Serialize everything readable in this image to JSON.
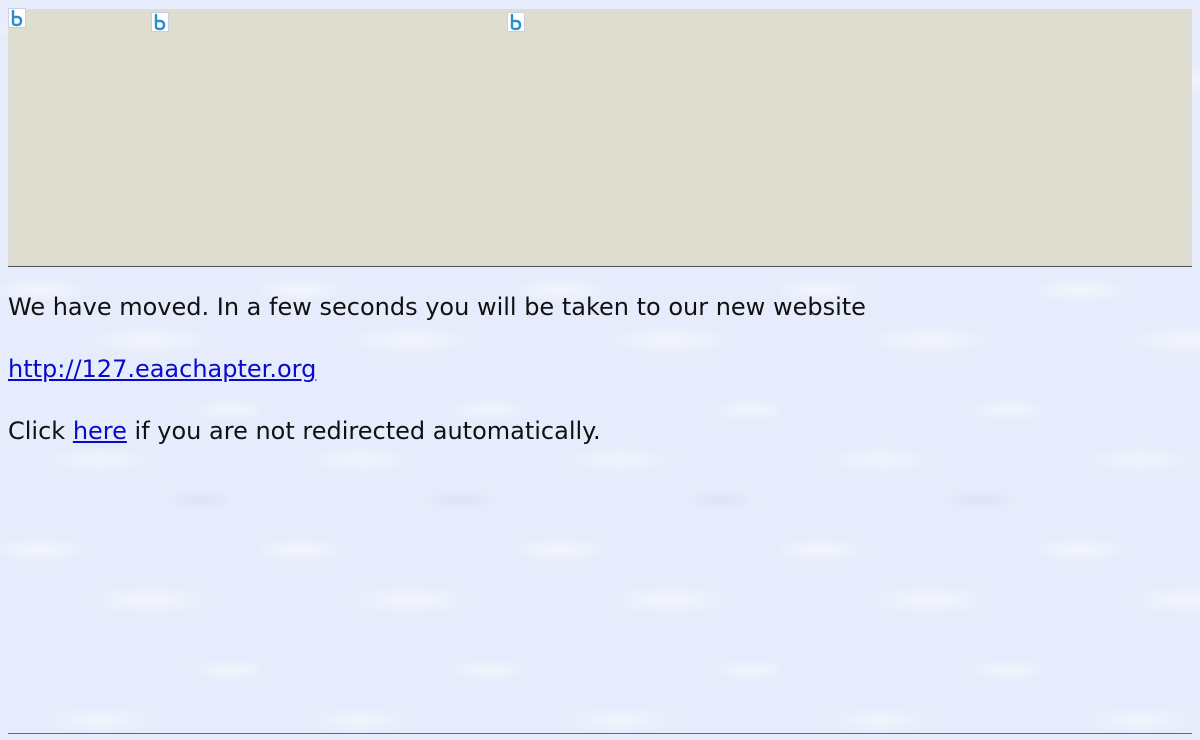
{
  "header": {
    "images": [
      {
        "icon": "broken-image-icon"
      },
      {
        "icon": "broken-image-icon"
      },
      {
        "icon": "broken-image-icon"
      }
    ],
    "panel_color": "#dfdcd0"
  },
  "content": {
    "moved_message": "We have moved. In a few seconds you will be taken to our new website",
    "new_site_link": "http://127.eaachapter.org",
    "click_prefix": "Click ",
    "here_link": "here",
    "click_suffix": " if you are not redirected automatically."
  },
  "colors": {
    "link": "#0a0acc",
    "text": "#111111",
    "background": "#e6ecfb"
  }
}
